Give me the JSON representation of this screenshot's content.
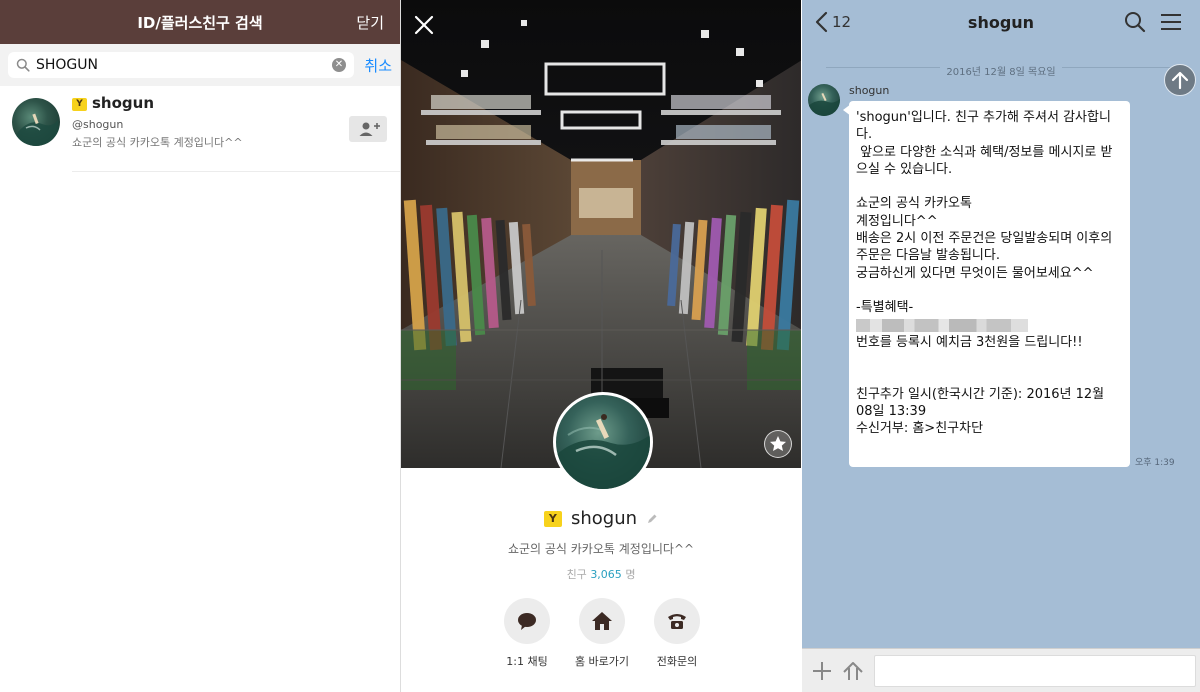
{
  "search_panel": {
    "title": "ID/플러스친구 검색",
    "close_label": "닫기",
    "search_value": "SHOGUN",
    "cancel_label": "취소",
    "result": {
      "badge": "Y",
      "name": "shogun",
      "id": "@shogun",
      "description": "쇼군의 공식 카카오톡 계정입니다^^"
    },
    "icons": [
      "search-icon",
      "clear-icon",
      "add-friend-icon"
    ]
  },
  "profile_panel": {
    "badge": "Y",
    "name": "shogun",
    "description": "쇼군의 공식 카카오톡 계정입니다^^",
    "friends_label": "친구",
    "friends_count": "3,065",
    "friends_unit": "명",
    "actions": [
      {
        "label": "1:1 채팅",
        "icon": "chat-icon"
      },
      {
        "label": "홈 바로가기",
        "icon": "home-icon"
      },
      {
        "label": "전화문의",
        "icon": "phone-icon"
      }
    ],
    "icons": [
      "close-icon",
      "star-icon",
      "edit-icon"
    ]
  },
  "chat_panel": {
    "back_count": "12",
    "title": "shogun",
    "date": "2016년 12월 8일 목요일",
    "sender": "shogun",
    "message_lines": [
      "'shogun'입니다. 친구 추가해 주셔서 감사합니",
      "다.",
      " 앞으로 다양한 소식과 혜택/정보를 메시지로 받",
      "으실 수 있습니다.",
      "",
      "쇼군의 공식 카카오톡",
      "계정입니다^^",
      "배송은 2시 이전 주문건은 당일발송되며 이후의",
      "주문은 다음날 발송됩니다.",
      "궁금하신게 있다면 무엇이든 물어보세요^^",
      "",
      "-특별혜택-",
      "",
      "번호를 등록시 예치금 3천원을 드립니다!!",
      "",
      "",
      "친구추가 일시(한국시간 기준): 2016년 12월",
      "08일 13:39",
      "수신거부: 홈>친구차단"
    ],
    "time": "오후 1:39",
    "input_placeholder": "",
    "icons": [
      "back-icon",
      "search-icon",
      "menu-icon",
      "scroll-top-icon",
      "plus-icon",
      "sharp-search-icon"
    ]
  },
  "colors": {
    "search_header": "#5a3e3a",
    "chat_background": "#a5bdd5",
    "accent_blue": "#1a8cff",
    "badge_yellow": "#f7d21c",
    "friends_count": "#2aa0c0"
  }
}
